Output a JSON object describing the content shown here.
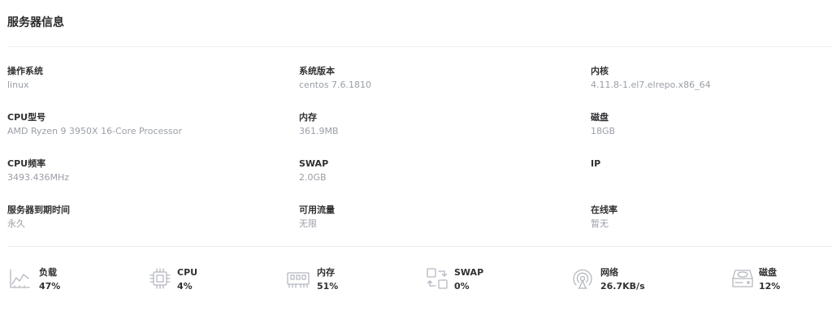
{
  "card": {
    "title": "服务器信息"
  },
  "info": {
    "rows": [
      [
        {
          "label": "操作系统",
          "value": "linux"
        },
        {
          "label": "系统版本",
          "value": "centos 7.6.1810"
        },
        {
          "label": "内核",
          "value": "4.11.8-1.el7.elrepo.x86_64"
        }
      ],
      [
        {
          "label": "CPU型号",
          "value": "AMD Ryzen 9 3950X 16-Core Processor"
        },
        {
          "label": "内存",
          "value": "361.9MB"
        },
        {
          "label": "磁盘",
          "value": "18GB"
        }
      ],
      [
        {
          "label": "CPU频率",
          "value": "3493.436MHz"
        },
        {
          "label": "SWAP",
          "value": "2.0GB"
        },
        {
          "label": "IP",
          "value": ""
        }
      ],
      [
        {
          "label": "服务器到期时间",
          "value": "永久"
        },
        {
          "label": "可用流量",
          "value": "无限"
        },
        {
          "label": "在线率",
          "value": "暂无"
        }
      ]
    ]
  },
  "stats": [
    {
      "label": "负载",
      "value": "47%",
      "icon": "line-chart-icon"
    },
    {
      "label": "CPU",
      "value": "4%",
      "icon": "cpu-chip-icon"
    },
    {
      "label": "内存",
      "value": "51%",
      "icon": "memory-module-icon"
    },
    {
      "label": "SWAP",
      "value": "0%",
      "icon": "swap-icon"
    },
    {
      "label": "网络",
      "value": "26.7KB/s",
      "icon": "network-antenna-icon"
    },
    {
      "label": "磁盘",
      "value": "12%",
      "icon": "hard-disk-icon"
    }
  ],
  "colors": {
    "icon_stroke": "#b4b8bf",
    "label": "#303133",
    "muted": "#9a9ea7"
  }
}
